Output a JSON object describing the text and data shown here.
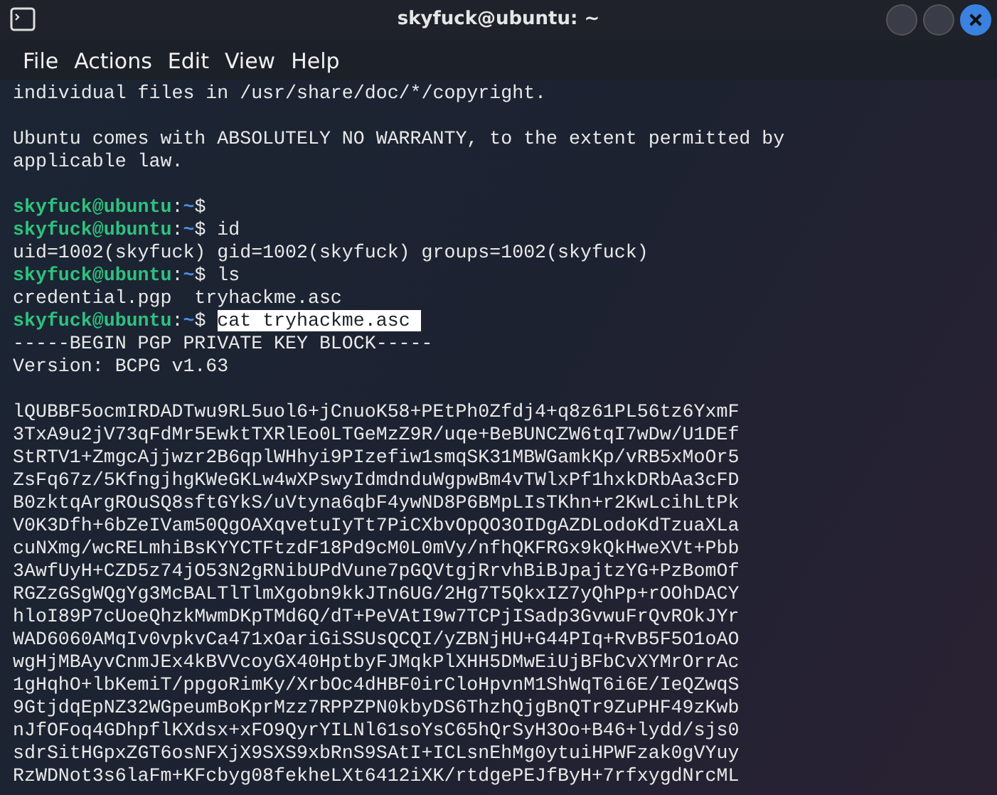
{
  "window": {
    "title": "skyfuck@ubuntu: ~"
  },
  "menu": [
    "File",
    "Actions",
    "Edit",
    "View",
    "Help"
  ],
  "terminal": {
    "lines": [
      {
        "kind": "text",
        "text": "individual files in /usr/share/doc/*/copyright."
      },
      {
        "kind": "blank"
      },
      {
        "kind": "text",
        "text": "Ubuntu comes with ABSOLUTELY NO WARRANTY, to the extent permitted by"
      },
      {
        "kind": "text",
        "text": "applicable law."
      },
      {
        "kind": "blank"
      },
      {
        "kind": "prompt",
        "user": "skyfuck@ubuntu",
        "sep": ":",
        "path": "~",
        "symbol": "$"
      },
      {
        "kind": "prompt",
        "user": "skyfuck@ubuntu",
        "sep": ":",
        "path": "~",
        "symbol": "$",
        "command": "id",
        "selected": false
      },
      {
        "kind": "text",
        "text": "uid=1002(skyfuck) gid=1002(skyfuck) groups=1002(skyfuck)"
      },
      {
        "kind": "prompt",
        "user": "skyfuck@ubuntu",
        "sep": ":",
        "path": "~",
        "symbol": "$",
        "command": "ls",
        "selected": false
      },
      {
        "kind": "text",
        "text": "credential.pgp  tryhackme.asc"
      },
      {
        "kind": "prompt",
        "user": "skyfuck@ubuntu",
        "sep": ":",
        "path": "~",
        "symbol": "$",
        "command": "cat tryhackme.asc ",
        "selected": true
      },
      {
        "kind": "text",
        "text": "-----BEGIN PGP PRIVATE KEY BLOCK-----"
      },
      {
        "kind": "text",
        "text": "Version: BCPG v1.63"
      },
      {
        "kind": "blank"
      },
      {
        "kind": "text",
        "text": "lQUBBF5ocmIRDADTwu9RL5uol6+jCnuoK58+PEtPh0Zfdj4+q8z61PL56tz6YxmF"
      },
      {
        "kind": "text",
        "text": "3TxA9u2jV73qFdMr5EwktTXRlEo0LTGeMzZ9R/uqe+BeBUNCZW6tqI7wDw/U1DEf"
      },
      {
        "kind": "text",
        "text": "StRTV1+ZmgcAjjwzr2B6qplWHhyi9PIzefiw1smqSK31MBWGamkKp/vRB5xMoOr5"
      },
      {
        "kind": "text",
        "text": "ZsFq67z/5KfngjhgKWeGKLw4wXPswyIdmdnduWgpwBm4vTWlxPf1hxkDRbAa3cFD"
      },
      {
        "kind": "text",
        "text": "B0zktqArgROuSQ8sftGYkS/uVtyna6qbF4ywND8P6BMpLIsTKhn+r2KwLcihLtPk"
      },
      {
        "kind": "text",
        "text": "V0K3Dfh+6bZeIVam50QgOAXqvetuIyTt7PiCXbvOpQO3OIDgAZDLodoKdTzuaXLa"
      },
      {
        "kind": "text",
        "text": "cuNXmg/wcRELmhiBsKYYCTFtzdF18Pd9cM0L0mVy/nfhQKFRGx9kQkHweXVt+Pbb"
      },
      {
        "kind": "text",
        "text": "3AwfUyH+CZD5z74jO53N2gRNibUPdVune7pGQVtgjRrvhBiBJpajtzYG+PzBomOf"
      },
      {
        "kind": "text",
        "text": "RGZzGSgWQgYg3McBALTlTlmXgobn9kkJTn6UG/2Hg7T5QkxIZ7yQhPp+rOOhDACY"
      },
      {
        "kind": "text",
        "text": "hloI89P7cUoeQhzkMwmDKpTMd6Q/dT+PeVAtI9w7TCPjISadp3GvwuFrQvROkJYr"
      },
      {
        "kind": "text",
        "text": "WAD6060AMqIv0vpkvCa471xOariGiSSUsQCQI/yZBNjHU+G44PIq+RvB5F5O1oAO"
      },
      {
        "kind": "text",
        "text": "wgHjMBAyvCnmJEx4kBVVcoyGX40HptbyFJMqkPlXHH5DMwEiUjBFbCvXYMrOrrAc"
      },
      {
        "kind": "text",
        "text": "1gHqhO+lbKemiT/ppgoRimKy/XrbOc4dHBF0irCloHpvnM1ShWqT6i6E/IeQZwqS"
      },
      {
        "kind": "text",
        "text": "9GtjdqEpNZ32WGpeumBoKprMzz7RPPZPN0kbyDS6ThzhQjgBnQTr9ZuPHF49zKwb"
      },
      {
        "kind": "text",
        "text": "nJfOFoq4GDhpflKXdsx+xFO9QyrYILNl61soYsC65hQrSyH3Oo+B46+lydd/sjs0"
      },
      {
        "kind": "text",
        "text": "sdrSitHGpxZGT6osNFXjX9SXS9xbRnS9SAtI+ICLsnEhMg0ytuiHPWFzak0gVYuy"
      },
      {
        "kind": "text",
        "text": "RzWDNot3s6laFm+KFcbyg08fekheLXt6412iXK/rtdgePEJfByH+7rfxygdNrcML"
      }
    ]
  }
}
